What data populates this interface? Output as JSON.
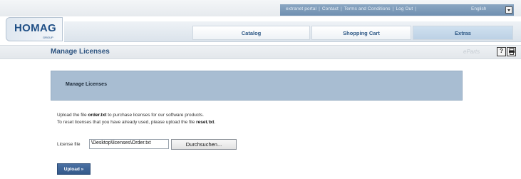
{
  "header": {
    "util_links": [
      "extranet portal",
      "Contact",
      "Terms and Conditions",
      "Log Out"
    ],
    "language": "English",
    "logo_text": "HOMAG",
    "logo_sub": "GROUP"
  },
  "nav": {
    "tabs": [
      {
        "label": "Catalog",
        "active": false
      },
      {
        "label": "Shopping Cart",
        "active": false
      },
      {
        "label": "Extras",
        "active": true
      }
    ]
  },
  "page": {
    "title": "Manage Licenses",
    "eparts_label": "eParts",
    "help_label": "?",
    "print_icon": "printer-icon"
  },
  "section": {
    "title": "Manage Licenses"
  },
  "instructions": {
    "line1_prefix": "Upload the file ",
    "line1_file": "order.txt",
    "line1_suffix": " to purchase licenses for our software products.",
    "line2_prefix": "To reset licenses that you have already used, please upload the file ",
    "line2_file": "reset.txt",
    "line2_suffix": "."
  },
  "form": {
    "file_label": "License file",
    "file_value": "\\Desktop\\licenses\\Order.txt",
    "browse_label": "Durchsuchen...",
    "upload_label": "Upload »"
  },
  "colors": {
    "brand_blue": "#1f4f86",
    "section_bg": "#a8bdd2",
    "upload_bg": "#3d6496"
  }
}
